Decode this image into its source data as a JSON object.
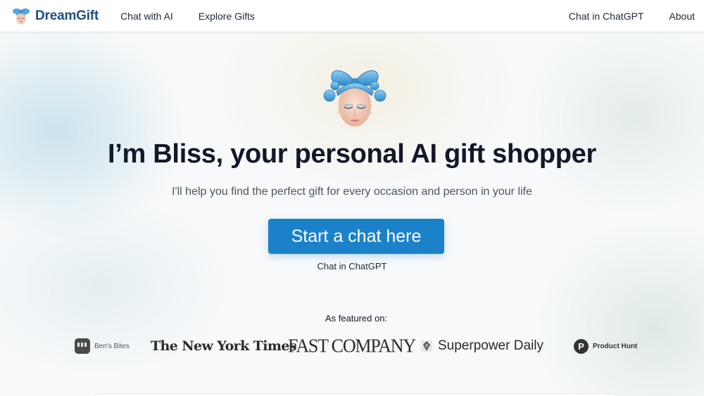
{
  "header": {
    "brand": "DreamGift",
    "nav_left": [
      "Chat with AI",
      "Explore Gifts"
    ],
    "nav_right": [
      "Chat in ChatGPT",
      "About"
    ]
  },
  "hero": {
    "title": "I’m Bliss, your personal AI gift shopper",
    "subtitle": "I'll help you find the perfect gift for every occasion and person in your life",
    "cta_label": "Start a chat here",
    "cta_sub": "Chat in ChatGPT"
  },
  "featured": {
    "heading": "As featured on:",
    "logos": [
      {
        "name": "Ben's Bites",
        "icon": "bens-bites-icon"
      },
      {
        "name": "The New York Times",
        "icon": "nyt-wordmark"
      },
      {
        "name": "FAST COMPANY",
        "icon": "fast-company-wordmark"
      },
      {
        "name": "Superpower Daily",
        "icon": "superpower-daily-icon"
      },
      {
        "name": "Product Hunt",
        "icon": "product-hunt-icon"
      }
    ]
  },
  "colors": {
    "brand": "#1f4f86",
    "cta": "#1b82c9",
    "ribbon": "#4fa8e0"
  }
}
